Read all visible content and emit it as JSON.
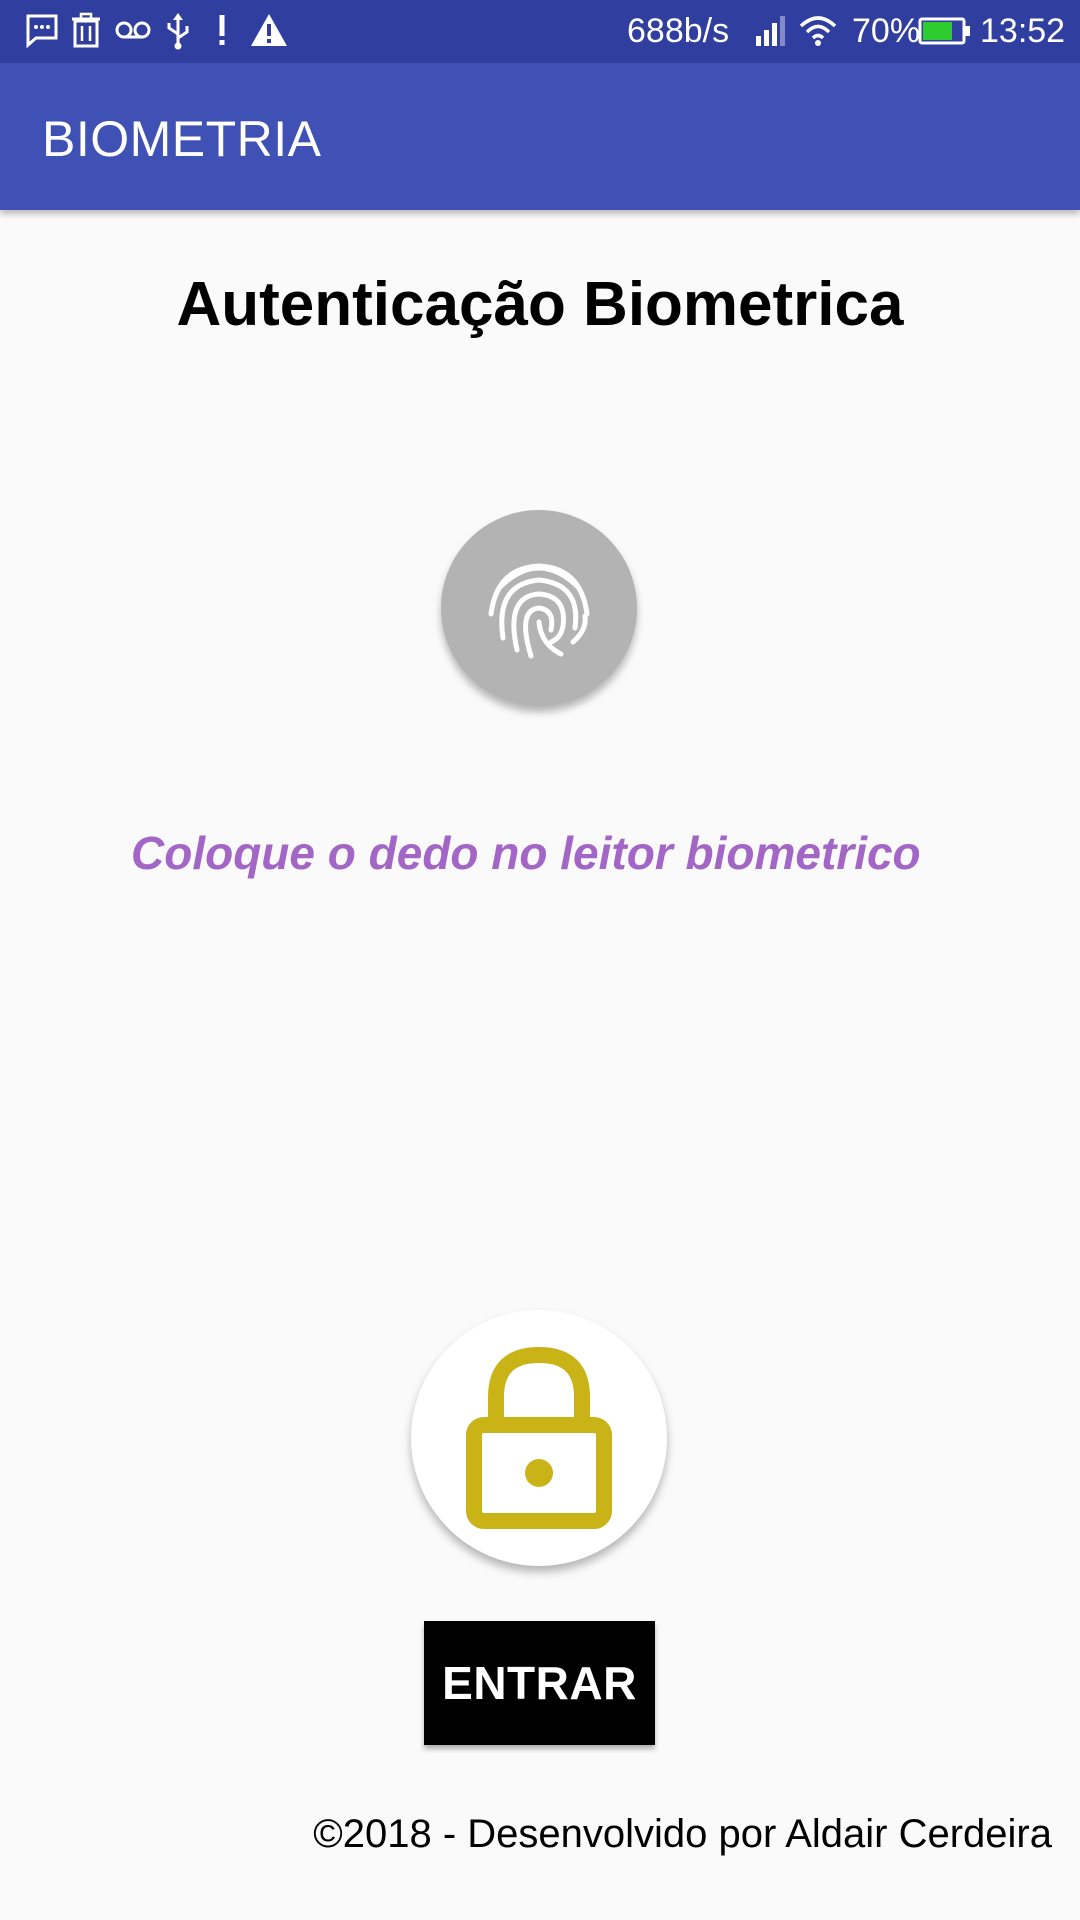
{
  "status_bar": {
    "icons": [
      "message-icon",
      "trash-icon",
      "voicemail-icon",
      "usb-icon",
      "alert-icon",
      "warning-icon",
      "signal-icon",
      "wifi-icon",
      "battery-icon"
    ],
    "network_speed": "688b/s",
    "battery_percent": "70%",
    "battery_level": 0.7,
    "time": "13:52"
  },
  "app_bar": {
    "title": "BIOMETRIA"
  },
  "main": {
    "title": "Autenticação Biometrica",
    "fingerprint_icon": "fingerprint-icon",
    "instruction": "Coloque o dedo no leitor biometrico",
    "lock_icon": "lock-icon",
    "enter_label": "ENTRAR",
    "footer": "©2018 - Desenvolvido por Aldair Cerdeira"
  },
  "colors": {
    "status_bar": "#303f9f",
    "app_bar": "#3f51b5",
    "instruction": "#a366c6",
    "lock": "#c9b316",
    "fingerprint_bg": "#b3b3b3",
    "battery_fill": "#2ecc2e"
  }
}
